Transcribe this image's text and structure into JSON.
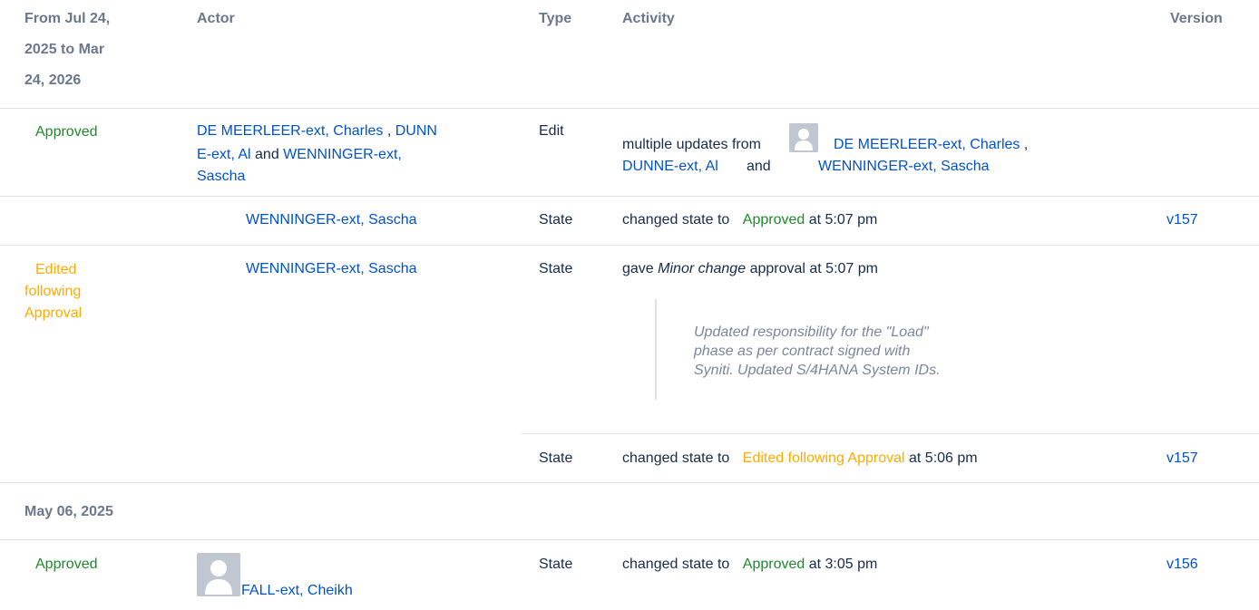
{
  "header": {
    "date_range": [
      "From Jul 24,",
      "2025 to Mar",
      "24, 2026"
    ],
    "actor": "Actor",
    "type": "Type",
    "activity": "Activity",
    "version": "Version"
  },
  "row1": {
    "status": "Approved",
    "actor_line1_a": "DE MEERLEER-ext, Charles",
    "actor_line1_sep": " , ",
    "actor_line1_b": "DUNN",
    "actor_line2_b": "E-ext, Al",
    "actor_line2_and": " and ",
    "actor_line2_c": "WENNINGER-ext,",
    "actor_line3_c": "Sascha",
    "type": "Edit",
    "activity_prefix": "multiple updates from",
    "activity_user1": "DE MEERLEER-ext, Charles",
    "activity_comma": " ,",
    "activity_user2": "DUNNE-ext, Al",
    "activity_and": "and",
    "activity_user3": "WENNINGER-ext, Sascha"
  },
  "row2": {
    "actor": "WENNINGER-ext, Sascha",
    "type": "State",
    "activity_prefix": "changed state to",
    "activity_state": "Approved",
    "activity_suffix": "at 5:07 pm",
    "version": "v157"
  },
  "row3": {
    "status_lines": [
      "Edited",
      "following",
      "Approval"
    ],
    "actor": "WENNINGER-ext, Sascha",
    "type": "State",
    "activity_prefix": "gave",
    "activity_em": "Minor change",
    "activity_suffix": "approval at 5:07 pm",
    "comment_lines": [
      "Updated responsibility for the \"Load\"",
      "phase as per contract signed with",
      "Syniti. Updated S/4HANA System IDs."
    ]
  },
  "row4": {
    "type": "State",
    "activity_prefix": "changed state to",
    "activity_state": "Edited following Approval",
    "activity_suffix": "at 5:06 pm",
    "version": "v157"
  },
  "group2": {
    "date": "May 06, 2025"
  },
  "row5": {
    "status": "Approved",
    "actor": "FALL-ext, Cheikh",
    "type": "State",
    "activity_prefix": "changed state to",
    "activity_state": "Approved",
    "activity_suffix": "at 3:05 pm",
    "version": "v156"
  },
  "icons": {
    "user_avatar": "user-avatar-icon"
  },
  "colors": {
    "link": "#0052cc",
    "approved": "#1f8a2c",
    "edited": "#ffab00",
    "header": "#6b778c",
    "divider": "#dfe1e6"
  }
}
